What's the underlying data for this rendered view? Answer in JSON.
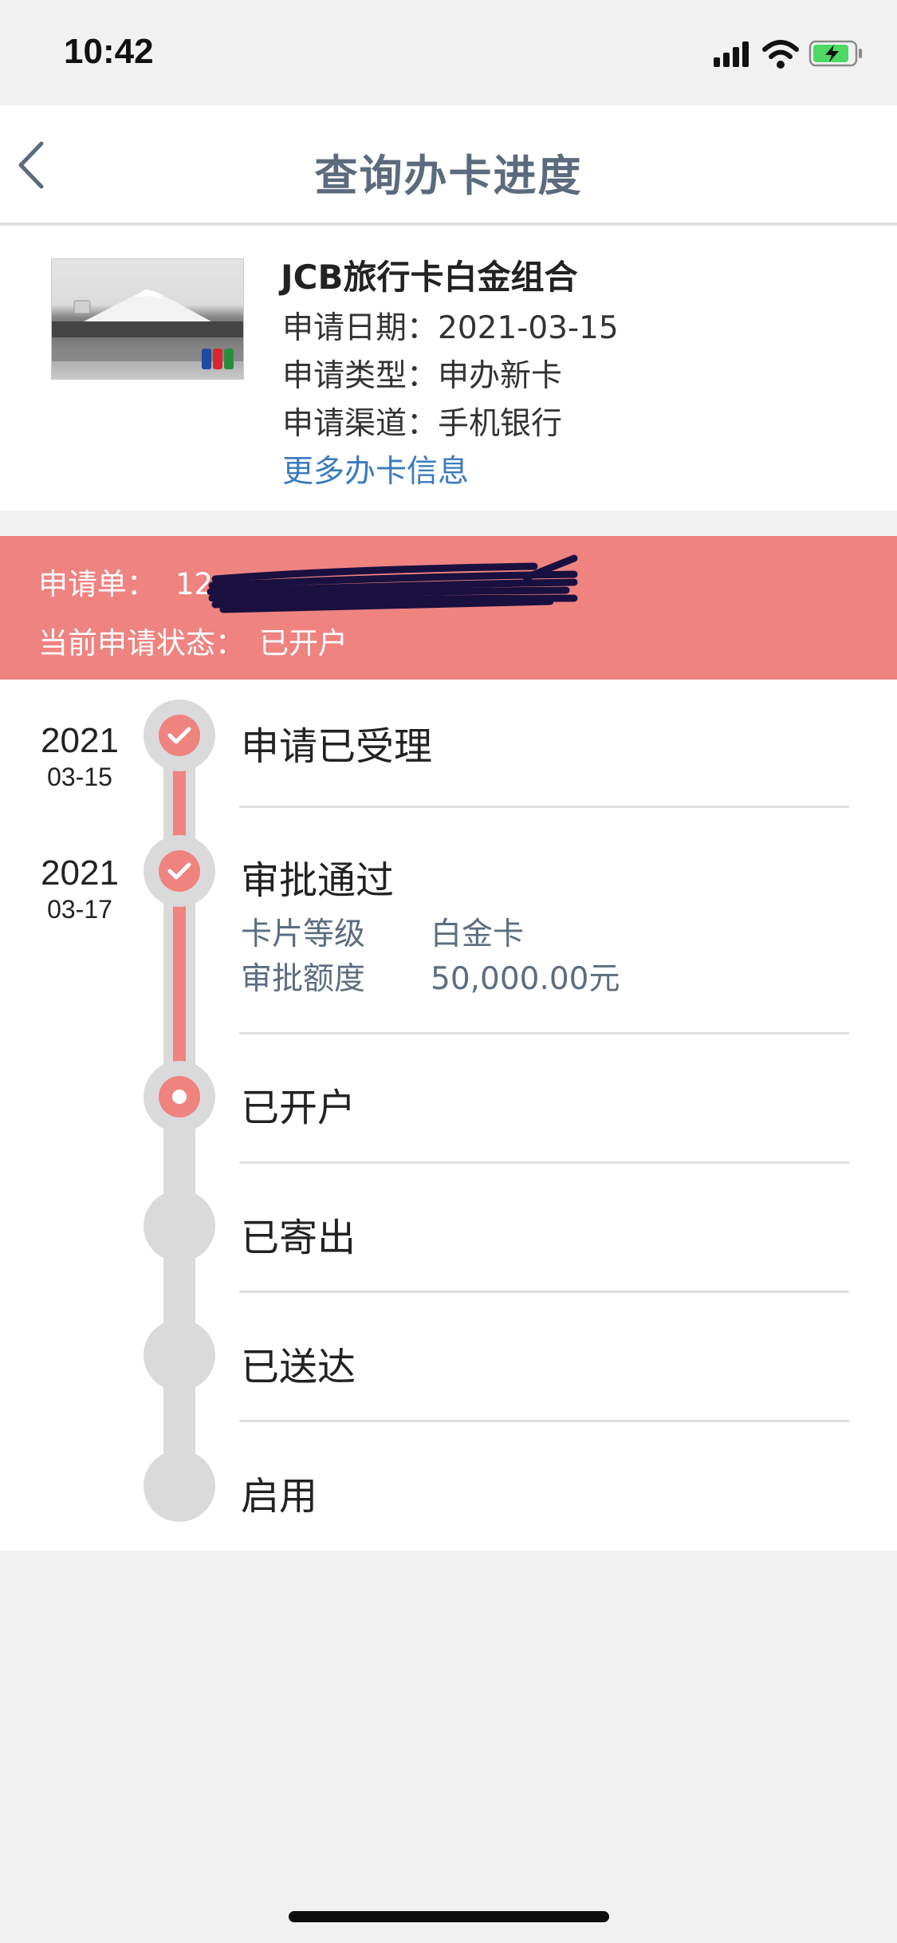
{
  "status_bar": {
    "time": "10:42"
  },
  "nav": {
    "title": "查询办卡进度"
  },
  "card": {
    "name": "JCB旅行卡白金组合",
    "apply_date": "申请日期：2021-03-15",
    "apply_type": "申请类型：申办新卡",
    "apply_channel": "申请渠道：手机银行",
    "more_info": "更多办卡信息"
  },
  "banner": {
    "application_label": "申请单：",
    "application_number_visible": "12",
    "status_label": "当前申请状态：",
    "status_value": "已开户"
  },
  "timeline": {
    "steps": [
      {
        "title": "申请已受理",
        "year": "2021",
        "md": "03-15",
        "state": "done"
      },
      {
        "title": "审批通过",
        "year": "2021",
        "md": "03-17",
        "state": "done",
        "details": [
          {
            "label": "卡片等级",
            "value": "白金卡"
          },
          {
            "label": "审批额度",
            "value": "50,000.00元"
          }
        ]
      },
      {
        "title": "已开户",
        "state": "current"
      },
      {
        "title": "已寄出",
        "state": "pending"
      },
      {
        "title": "已送达",
        "state": "pending"
      },
      {
        "title": "启用",
        "state": "pending"
      }
    ]
  },
  "colors": {
    "accent": "#ef8380",
    "link": "#3a7bbd",
    "title": "#5b6b7d",
    "track": "#dadada",
    "detail_text": "#5d6d80"
  },
  "icons": [
    "back-chevron-icon",
    "signal-icon",
    "wifi-icon",
    "battery-charging-icon",
    "check-icon"
  ]
}
